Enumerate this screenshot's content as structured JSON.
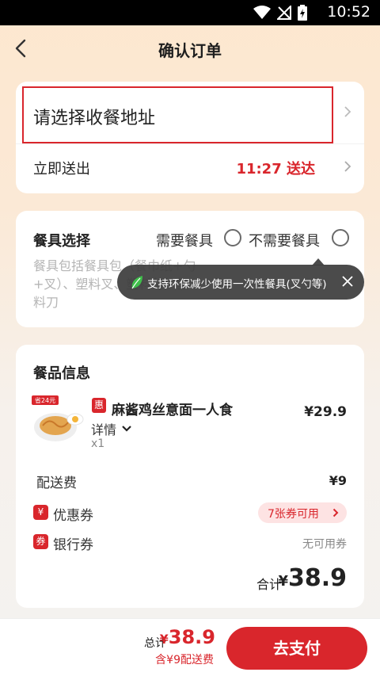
{
  "status_bar": {
    "time": "10:52"
  },
  "header": {
    "title": "确认订单"
  },
  "address": {
    "placeholder_text": "请选择收餐地址"
  },
  "delivery": {
    "label": "立即送出",
    "eta": "11:27 送达"
  },
  "utensils": {
    "title": "餐具选择",
    "option_need": "需要餐具",
    "option_no_need": "不需要餐具",
    "description": "餐具包括餐具包（餐巾纸+勺+叉）、塑料叉、塑料勺、塑料刀"
  },
  "tooltip": {
    "text": "支持环保减少使用一次性餐具(叉勺等)"
  },
  "meal": {
    "title": "餐品信息",
    "image_badge": "省24元",
    "item": {
      "badge": "惠",
      "name": "麻酱鸡丝意面一人食",
      "detail_label": "详情",
      "quantity": "x1",
      "price": "¥29.9"
    },
    "delivery_fee_label": "配送费",
    "delivery_fee_value": "¥9",
    "coupon": {
      "icon_text": "¥",
      "label": "优惠券",
      "chip": "7张券可用"
    },
    "bank_coupon": {
      "icon_text": "券",
      "label": "银行券",
      "value": "无可用券"
    },
    "total_label": "合计",
    "total_currency": "¥",
    "total_value": "38.9"
  },
  "bottom_bar": {
    "total_label": "总计",
    "currency": "¥",
    "total": "38.9",
    "fee_note": "含¥9配送费",
    "pay_button": "去支付"
  },
  "colors": {
    "accent": "#d9262c",
    "chip_bg": "#fde3e3",
    "tooltip_bg": "#3c3c3c"
  },
  "icons": [
    "back-icon",
    "chevron-right-icon",
    "leaf-icon",
    "close-icon",
    "chevron-down-icon",
    "wifi-icon",
    "no-signal-icon",
    "battery-charging-icon"
  ]
}
